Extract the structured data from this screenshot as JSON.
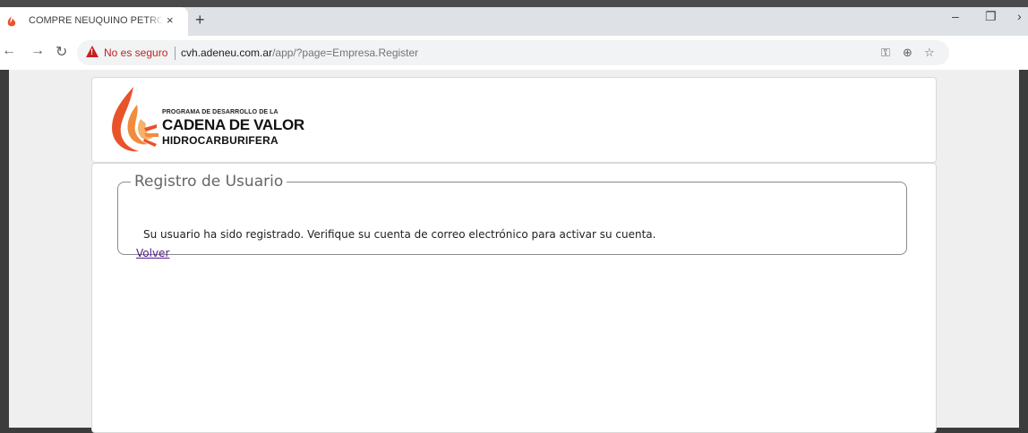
{
  "browser": {
    "tab_title": "COMPRE NEUQUINO PETROLERO",
    "tab_close": "×",
    "new_tab": "+",
    "window_min": "–",
    "window_restore": "❐",
    "window_more": "›",
    "security_label": "No es seguro",
    "url_host": "cvh.adeneu.com.ar",
    "url_path": "/app/?page=Empresa.Register",
    "colors": {
      "warning": "#c5221f"
    }
  },
  "logo": {
    "line1": "PROGRAMA DE DESARROLLO DE LA",
    "line2": "CADENA DE VALOR",
    "line3": "HIDROCARBURIFERA"
  },
  "register": {
    "legend": "Registro de Usuario",
    "message": "Su usuario ha sido registrado. Verifique su cuenta de correo electrónico para activar su cuenta.",
    "back_link": "Volver"
  }
}
